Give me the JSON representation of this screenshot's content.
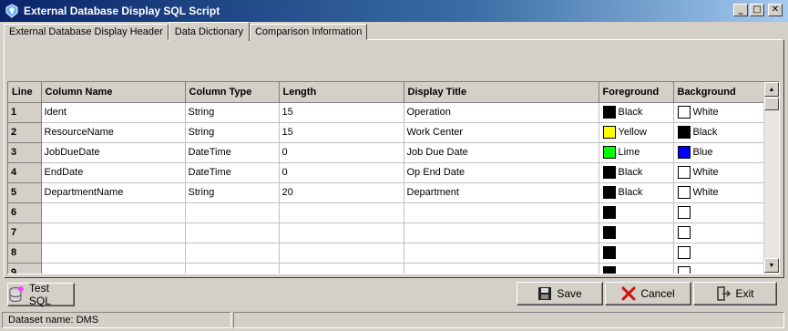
{
  "window": {
    "title": "External Database Display SQL Script",
    "controls": {
      "minimize": "_",
      "maximize": "□",
      "close": "✕"
    }
  },
  "tabs": [
    {
      "label": "External Database Display Header",
      "active": false
    },
    {
      "label": "Data Dictionary",
      "active": true
    },
    {
      "label": "Comparison Information",
      "active": false
    }
  ],
  "grid": {
    "columns": [
      "Line",
      "Column Name",
      "Column Type",
      "Length",
      "Display Title",
      "Foreground",
      "Background"
    ],
    "rows": [
      {
        "line": "1",
        "column_name": "Ident",
        "column_type": "String",
        "length": "15",
        "display_title": "Operation",
        "fg": "Black",
        "fg_color": "#000000",
        "bg": "White",
        "bg_color": "#ffffff"
      },
      {
        "line": "2",
        "column_name": "ResourceName",
        "column_type": "String",
        "length": "15",
        "display_title": "Work Center",
        "fg": "Yellow",
        "fg_color": "#ffff00",
        "bg": "Black",
        "bg_color": "#000000"
      },
      {
        "line": "3",
        "column_name": "JobDueDate",
        "column_type": "DateTime",
        "length": "0",
        "display_title": "Job Due Date",
        "fg": "Lime",
        "fg_color": "#00ff00",
        "bg": "Blue",
        "bg_color": "#0000ff"
      },
      {
        "line": "4",
        "column_name": "EndDate",
        "column_type": "DateTime",
        "length": "0",
        "display_title": "Op End Date",
        "fg": "Black",
        "fg_color": "#000000",
        "bg": "White",
        "bg_color": "#ffffff"
      },
      {
        "line": "5",
        "column_name": "DepartmentName",
        "column_type": "String",
        "length": "20",
        "display_title": "Department",
        "fg": "Black",
        "fg_color": "#000000",
        "bg": "White",
        "bg_color": "#ffffff"
      },
      {
        "line": "6",
        "column_name": "",
        "column_type": "",
        "length": "",
        "display_title": "",
        "fg": "",
        "fg_color": "#000000",
        "bg": "",
        "bg_color": "#ffffff"
      },
      {
        "line": "7",
        "column_name": "",
        "column_type": "",
        "length": "",
        "display_title": "",
        "fg": "",
        "fg_color": "#000000",
        "bg": "",
        "bg_color": "#ffffff"
      },
      {
        "line": "8",
        "column_name": "",
        "column_type": "",
        "length": "",
        "display_title": "",
        "fg": "",
        "fg_color": "#000000",
        "bg": "",
        "bg_color": "#ffffff"
      },
      {
        "line": "9",
        "column_name": "",
        "column_type": "",
        "length": "",
        "display_title": "",
        "fg": "",
        "fg_color": "#000000",
        "bg": "",
        "bg_color": "#ffffff"
      }
    ]
  },
  "buttons": {
    "test_sql": "Test SQL",
    "save": "Save",
    "cancel": "Cancel",
    "exit": "Exit"
  },
  "status": {
    "dataset": "Dataset name:  DMS",
    "extra": ""
  }
}
